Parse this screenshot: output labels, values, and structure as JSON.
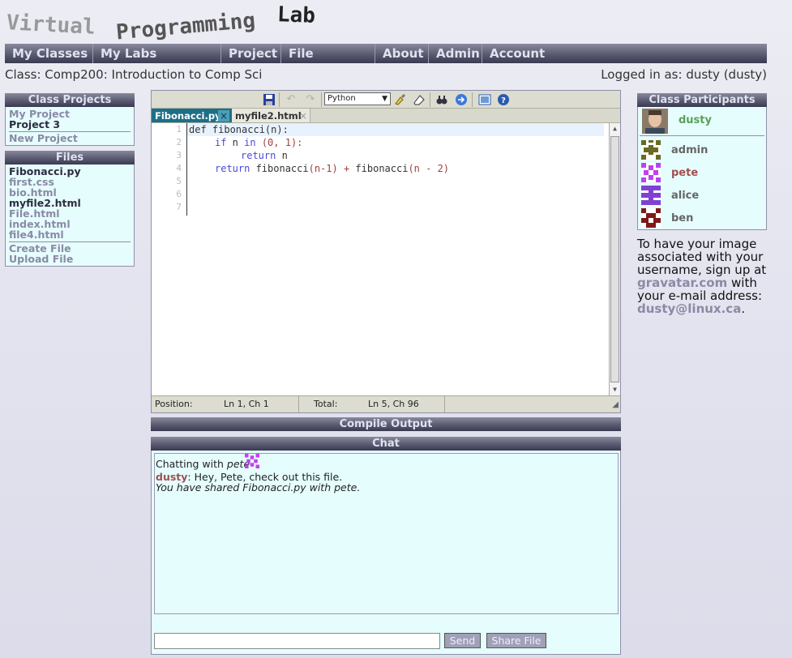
{
  "logo": {
    "word1": "Virtual",
    "word2": "Programming",
    "word3": "Lab"
  },
  "menu": [
    "My Classes",
    "My Labs",
    "Project",
    "File",
    "About",
    "Admin",
    "Account"
  ],
  "class_line": "Class: Comp200: Introduction to Comp Sci",
  "logged_in": "Logged in as: dusty (dusty)",
  "class_projects": {
    "title": "Class Projects",
    "items": [
      "My Project",
      "Project 3"
    ],
    "new_project": "New Project"
  },
  "files": {
    "title": "Files",
    "items": [
      "Fibonacci.py",
      "first.css",
      "bio.html",
      "myfile2.html",
      "File.html",
      "index.html",
      "file4.html"
    ],
    "create": "Create File",
    "upload": "Upload File"
  },
  "editor": {
    "language": "Python",
    "tabs": [
      "Fibonacci.py",
      "myfile2.html"
    ],
    "close_glyph": "×",
    "line_numbers": [
      "1",
      "2",
      "3",
      "4",
      "5",
      "6",
      "7"
    ],
    "code": {
      "l1a": "def fibonacci",
      "l1b": "(n):",
      "l2a": "if",
      "l2b": " n ",
      "l2c": "in",
      "l2d": " (0, 1):",
      "l3a": "return",
      "l3b": " n",
      "l4a": "return",
      "l4b": " fibonacci",
      "l4c": "(n-1)",
      "l4d": " + ",
      "l4e": "fibonacci",
      "l4f": "(n - 2)"
    },
    "status": {
      "position_label": "Position:",
      "position_value": "Ln 1, Ch 1",
      "total_label": "Total:",
      "total_value": "Ln 5, Ch 96"
    }
  },
  "compile_output": {
    "title": "Compile Output"
  },
  "chat": {
    "title": "Chat",
    "chatting_prefix": "Chatting with",
    "chatting_user": "pete",
    "msg_user": "dusty",
    "msg_text": ": Hey, Pete, check out this file.",
    "notice": "You have shared Fibonacci.py with pete.",
    "send": "Send",
    "share": "Share File"
  },
  "participants": {
    "title": "Class Participants",
    "list": [
      {
        "name": "dusty",
        "color": "#5aa05a"
      },
      {
        "name": "admin",
        "color": "#666666"
      },
      {
        "name": "pete",
        "color": "#a05050"
      },
      {
        "name": "alice",
        "color": "#666666"
      },
      {
        "name": "ben",
        "color": "#666666"
      }
    ]
  },
  "gravatar": {
    "text1": "To have your image associated with your username, sign up at",
    "link": "gravatar.com",
    "text2": "with your e-mail address:",
    "email": "dusty@linux.ca",
    "end": "."
  }
}
